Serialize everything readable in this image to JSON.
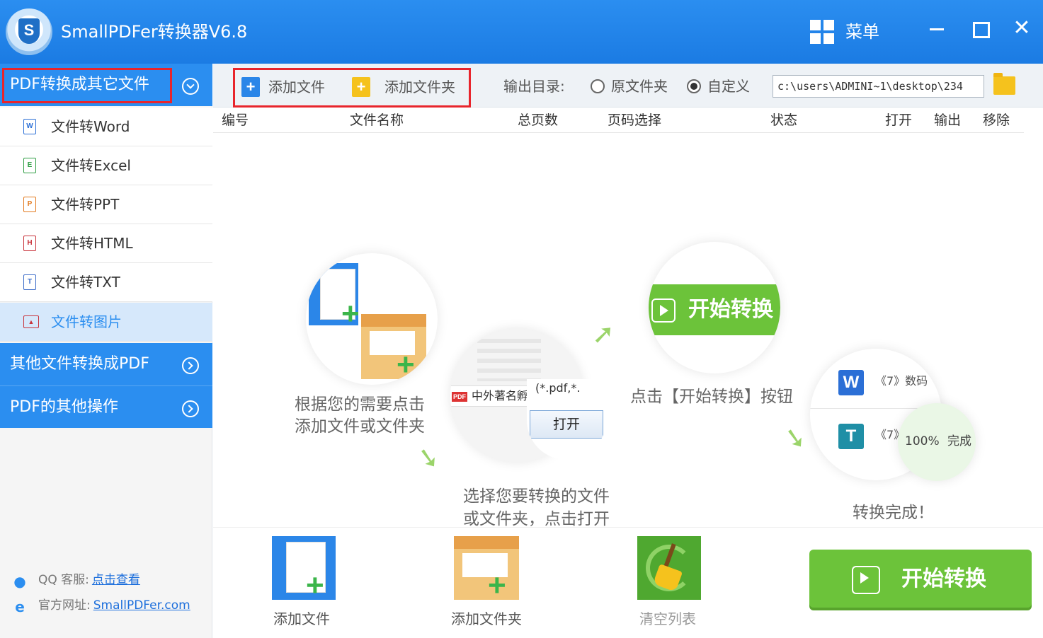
{
  "app": {
    "title": "SmallPDFer转换器V6.8",
    "menu_label": "菜单",
    "close_glyph": "✕",
    "logo_letter": "S"
  },
  "sidebar": {
    "categories": [
      {
        "label": "PDF转换成其它文件"
      },
      {
        "label": "其他文件转换成PDF"
      },
      {
        "label": "PDF的其他操作"
      }
    ],
    "items": [
      {
        "label": "文件转Word",
        "icon": "W"
      },
      {
        "label": "文件转Excel",
        "icon": "E"
      },
      {
        "label": "文件转PPT",
        "icon": "P"
      },
      {
        "label": "文件转HTML",
        "icon": "H"
      },
      {
        "label": "文件转TXT",
        "icon": "T"
      },
      {
        "label": "文件转图片",
        "icon": "▲"
      }
    ],
    "qq_label": "QQ 客服:",
    "qq_link": "点击查看",
    "site_label": "官方网址:",
    "site_link": "SmallPDFer.com"
  },
  "toolbar": {
    "add_file": "添加文件",
    "add_folder": "添加文件夹",
    "output_label": "输出目录:",
    "radio_original": "原文件夹",
    "radio_custom": "自定义",
    "output_path": "c:\\users\\ADMINI~1\\desktop\\234",
    "plus_glyph": "+"
  },
  "table": {
    "columns": [
      "编号",
      "文件名称",
      "总页数",
      "页码选择",
      "状态",
      "打开",
      "输出",
      "移除"
    ]
  },
  "guide": {
    "step1_text": [
      "根据您的需要点击",
      "添加文件或文件夹"
    ],
    "step2_text": [
      "选择您要转换的文件",
      "或文件夹，点击打开"
    ],
    "step3_text": "点击【开始转换】按钮",
    "step4_text": "转换完成！",
    "step2_file": "中外著名孵",
    "step2_filter": "(*.pdf,*.",
    "step2_pdf_tag": "PDF",
    "step2_open": "打开",
    "step3_start": "开始转换",
    "step4_row1": "《7》数码",
    "step4_row2": "《7》",
    "step4_percent": "100%",
    "step4_done": "完成",
    "step4_w": "W",
    "step4_t": "T",
    "arrow_glyph": "➚"
  },
  "bottom": {
    "add_file": "添加文件",
    "add_folder": "添加文件夹",
    "clear_list": "清空列表",
    "start": "开始转换"
  },
  "colors": {
    "primary_blue": "#2b8ef0",
    "highlight_red": "#e8252c",
    "start_green": "#6cc33a"
  }
}
